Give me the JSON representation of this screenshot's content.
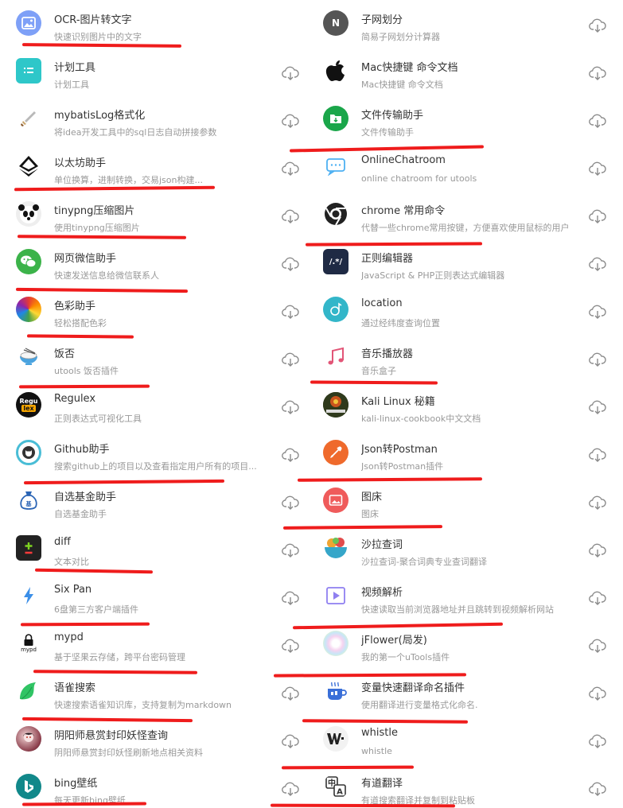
{
  "left_plugins": [
    {
      "title": "OCR-图片转文字",
      "desc": "快速识别图片中的文字",
      "icon": "image-icon",
      "color": "#7ea0f7",
      "downloaded": true
    },
    {
      "title": "计划工具",
      "desc": "计划工具",
      "icon": "folder-list-icon",
      "color": "#2ec7c9",
      "downloaded": false
    },
    {
      "title": "mybatisLog格式化",
      "desc": "将idea开发工具中的sql日志自动拼接参数",
      "icon": "sword-icon",
      "color": "#c9a46b",
      "downloaded": false
    },
    {
      "title": "以太坊助手",
      "desc": "单位换算，进制转换，交易json构建...",
      "icon": "ethereum-icon",
      "color": "#222222",
      "downloaded": false
    },
    {
      "title": "tinypng压缩图片",
      "desc": "使用tinypng压缩图片",
      "icon": "panda-icon",
      "color": "#dddddd",
      "downloaded": false
    },
    {
      "title": "网页微信助手",
      "desc": "快速发送信息给微信联系人",
      "icon": "wechat-icon",
      "color": "#3cb34a",
      "downloaded": false
    },
    {
      "title": "色彩助手",
      "desc": "轻松搭配色彩",
      "icon": "color-wheel-icon",
      "color": "#e94f37",
      "downloaded": false
    },
    {
      "title": "饭否",
      "desc": "utools 饭否插件",
      "icon": "rice-bowl-icon",
      "color": "#4aa3df",
      "downloaded": false
    },
    {
      "title": "Regulex",
      "desc": "正则表达式可视化工具",
      "icon": "regulex-icon",
      "color": "#111111",
      "downloaded": false
    },
    {
      "title": "Github助手",
      "desc": "搜索github上的项目以及查看指定用户所有的项目...",
      "icon": "github-icon",
      "color": "#49bdd6",
      "downloaded": false
    },
    {
      "title": "自选基金助手",
      "desc": "自选基金助手",
      "icon": "fund-bag-icon",
      "color": "#2a64b5",
      "downloaded": false
    },
    {
      "title": "diff",
      "desc": "文本对比",
      "icon": "diff-icon",
      "color": "#222222",
      "downloaded": false
    },
    {
      "title": "Six Pan",
      "desc": "6盘第三方客户端插件",
      "icon": "lightning-icon",
      "color": "#3b8fe8",
      "downloaded": false
    },
    {
      "title": "mypd",
      "desc": "基于坚果云存储，跨平台密码管理",
      "icon": "lock-icon",
      "color": "#222222",
      "downloaded": false
    },
    {
      "title": "语雀搜索",
      "desc": "快速搜索语雀知识库，支持复制为markdown",
      "icon": "yuque-icon",
      "color": "#30c464",
      "downloaded": false
    },
    {
      "title": "阴阳师悬赏封印妖怪查询",
      "desc": "阴阳师悬赏封印妖怪刷新地点相关资料",
      "icon": "onmyoji-icon",
      "color": "#8a3c4a",
      "downloaded": false
    },
    {
      "title": "bing壁纸",
      "desc": "每天更新bing壁纸",
      "icon": "bing-icon",
      "color": "#11888a",
      "downloaded": false
    }
  ],
  "right_plugins": [
    {
      "title": "子网划分",
      "desc": "简易子网划分计算器",
      "icon": "letter-n-icon",
      "color": "#555555",
      "downloaded": false
    },
    {
      "title": "Mac快捷键 命令文档",
      "desc": "Mac快捷键 命令文档",
      "icon": "apple-icon",
      "color": "#111111",
      "downloaded": false
    },
    {
      "title": "文件传输助手",
      "desc": "文件传输助手",
      "icon": "file-transfer-icon",
      "color": "#1aa64a",
      "downloaded": false
    },
    {
      "title": "OnlineChatroom",
      "desc": "online chatroom for utools",
      "icon": "chat-bubble-icon",
      "color": "#4db0f2",
      "downloaded": false
    },
    {
      "title": "chrome 常用命令",
      "desc": "代替一些chrome常用按键，方便喜欢使用鼠标的用户",
      "icon": "chrome-icon",
      "color": "#222222",
      "downloaded": false
    },
    {
      "title": "正则编辑器",
      "desc": "JavaScript & PHP正则表达式编辑器",
      "icon": "regex-editor-icon",
      "color": "#1f2a44",
      "downloaded": false
    },
    {
      "title": "location",
      "desc": "通过经纬度查询位置",
      "icon": "location-icon",
      "color": "#33b6c9",
      "downloaded": false
    },
    {
      "title": "音乐播放器",
      "desc": "音乐盒子",
      "icon": "music-note-icon",
      "color": "#e25577",
      "downloaded": false
    },
    {
      "title": "Kali Linux 秘籍",
      "desc": "kali-linux-cookbook中文文档",
      "icon": "kali-book-icon",
      "color": "#4a5a2a",
      "downloaded": false
    },
    {
      "title": "Json转Postman",
      "desc": "Json转Postman插件",
      "icon": "postman-icon",
      "color": "#ef6a2c",
      "downloaded": false
    },
    {
      "title": "图床",
      "desc": "图床",
      "icon": "picture-icon",
      "color": "#ef5b5b",
      "downloaded": false
    },
    {
      "title": "沙拉查词",
      "desc": "沙拉查词-聚合词典专业查词翻译",
      "icon": "salad-icon",
      "color": "#f0a531",
      "downloaded": false
    },
    {
      "title": "视频解析",
      "desc": "快速读取当前浏览器地址并且跳转到视频解析网站",
      "icon": "video-play-icon",
      "color": "#8f7ff0",
      "downloaded": false
    },
    {
      "title": "jFlower(局发)",
      "desc": "我的第一个uTools插件",
      "icon": "flower-icon",
      "color": "#d9a6e8",
      "downloaded": false
    },
    {
      "title": "变量快速翻译命名插件",
      "desc": "使用翻译进行变量格式化命名.",
      "icon": "coffee-cup-icon",
      "color": "#3a6fd8",
      "downloaded": false
    },
    {
      "title": "whistle",
      "desc": "whistle",
      "icon": "whistle-icon",
      "color": "#222222",
      "downloaded": false
    },
    {
      "title": "有道翻译",
      "desc": "有道搜索翻译并复制到粘贴板",
      "icon": "translate-icon",
      "color": "#333333",
      "downloaded": false
    }
  ]
}
